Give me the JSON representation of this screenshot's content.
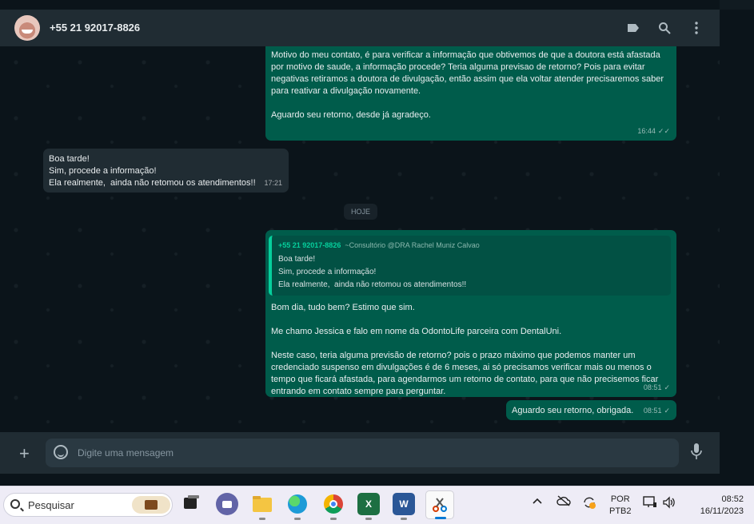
{
  "header": {
    "contact_name": "+55 21 92017-8826",
    "icons": [
      "label-icon",
      "search-icon",
      "menu-icon"
    ]
  },
  "messages": {
    "m1": {
      "text": "Me chamo Jessica e falo em nome da OdontoLife parceira com DentalUni.\n\nMotivo do meu contato, é para verificar a informação que obtivemos de que a doutora está afastada por motivo de saude, a informação procede? Teria alguma previsao de retorno? Pois para evitar negativas retiramos a doutora de divulgação, então assim que ela voltar atender precisaremos saber para reativar a divulgação novamente.\n\nAguardo seu retorno, desde já agradeço.",
      "time": "16:44",
      "status": "✓✓"
    },
    "m2": {
      "text": "Boa tarde!\nSim, procede a informação!\nEla realmente,  ainda não retomou os atendimentos!!",
      "time": "17:21"
    },
    "date_chip": "HOJE",
    "m3": {
      "quote_author": "+55 21 92017-8826",
      "quote_group": "~Consultório @DRA Rachel Muniz Calvao",
      "quote_text": "Boa tarde!\nSim, procede a informação!\nEla realmente,  ainda não retomou os atendimentos!!",
      "text": "Bom dia, tudo bem? Estimo que sim.\n\nMe chamo Jessica e falo em nome da OdontoLife parceira com DentalUni.\n\nNeste caso, teria alguma previsão de retorno? pois o prazo máximo que podemos manter um credenciado suspenso em divulgações é de 6 meses, ai só precisamos verificar mais ou menos o tempo que ficará afastada, para agendarmos um retorno de contato, para que não precisemos ficar entrando em contato sempre para perguntar.",
      "time": "08:51",
      "status": "✓"
    },
    "m4": {
      "text": "Aguardo seu retorno, obrigada.",
      "time": "08:51",
      "status": "✓"
    }
  },
  "footer": {
    "placeholder": "Digite uma mensagem"
  },
  "taskbar": {
    "search_label": "Pesquisar",
    "language": "POR",
    "layout": "PTB2",
    "time": "08:52",
    "date": "16/11/2023"
  },
  "colors": {
    "outgoing_bubble": "#005c4b",
    "incoming_bubble": "#202c33",
    "accent": "#06cf9c"
  }
}
